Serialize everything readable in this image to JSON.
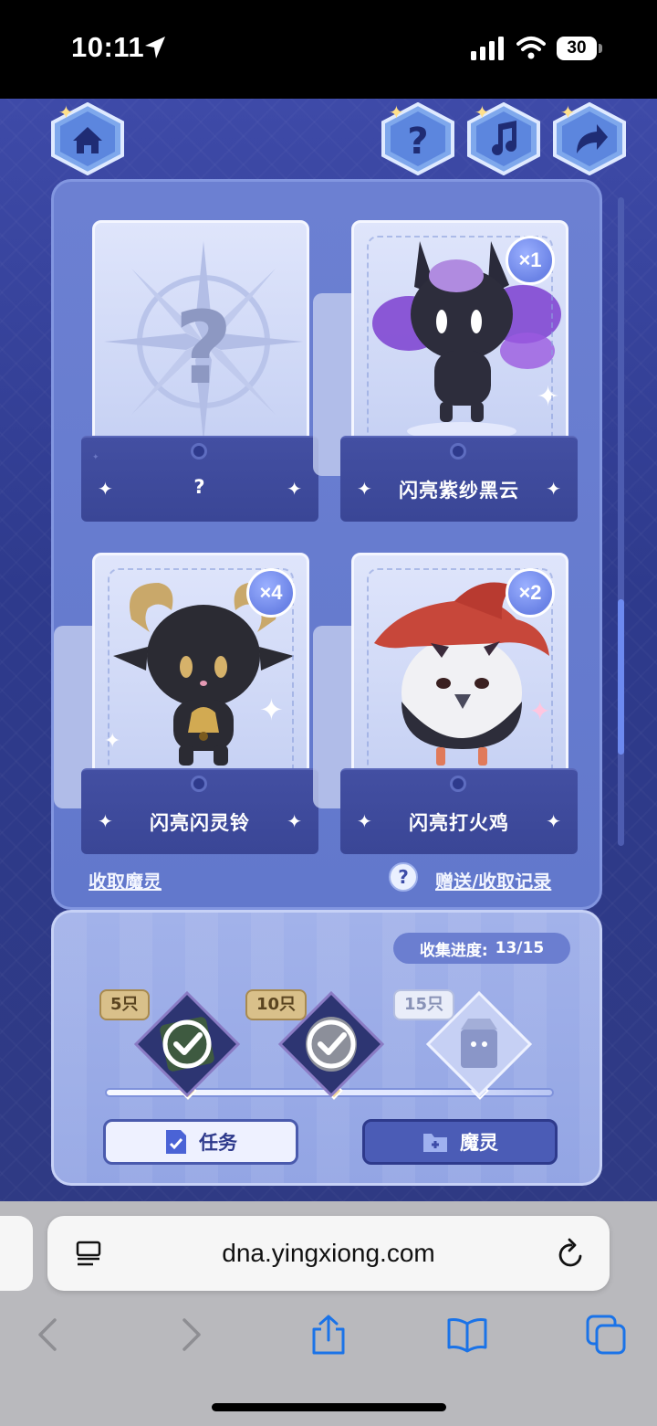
{
  "status_bar": {
    "time": "10:11",
    "battery": "30"
  },
  "top_buttons": {
    "home_icon": "home-icon",
    "help_icon": "question-icon",
    "music_icon": "music-note-icon",
    "share_icon": "share-arrow-icon"
  },
  "cards": [
    {
      "name": "?",
      "count": "",
      "state": "unknown"
    },
    {
      "name": "闪亮紫纱黑云",
      "count": "×1",
      "state": "owned"
    },
    {
      "name": "闪亮闪灵铃",
      "count": "×4",
      "state": "owned"
    },
    {
      "name": "闪亮打火鸡",
      "count": "×2",
      "state": "owned"
    }
  ],
  "links": {
    "collect": "收取魔灵",
    "history": "赠送/收取记录"
  },
  "progress": {
    "label": "收集进度:",
    "value": "13/15",
    "milestones": [
      {
        "label": "5只",
        "done": true
      },
      {
        "label": "10只",
        "done": true
      },
      {
        "label": "15只",
        "done": false
      }
    ]
  },
  "tabs": {
    "task": "任务",
    "spirit": "魔灵"
  },
  "browser": {
    "url": "dna.yingxiong.com"
  },
  "colors": {
    "bg_dark": "#2e3a8c",
    "panel": "#6c80d2",
    "panel_light": "#a2b2ea",
    "accent_gold": "#c9a86a"
  }
}
